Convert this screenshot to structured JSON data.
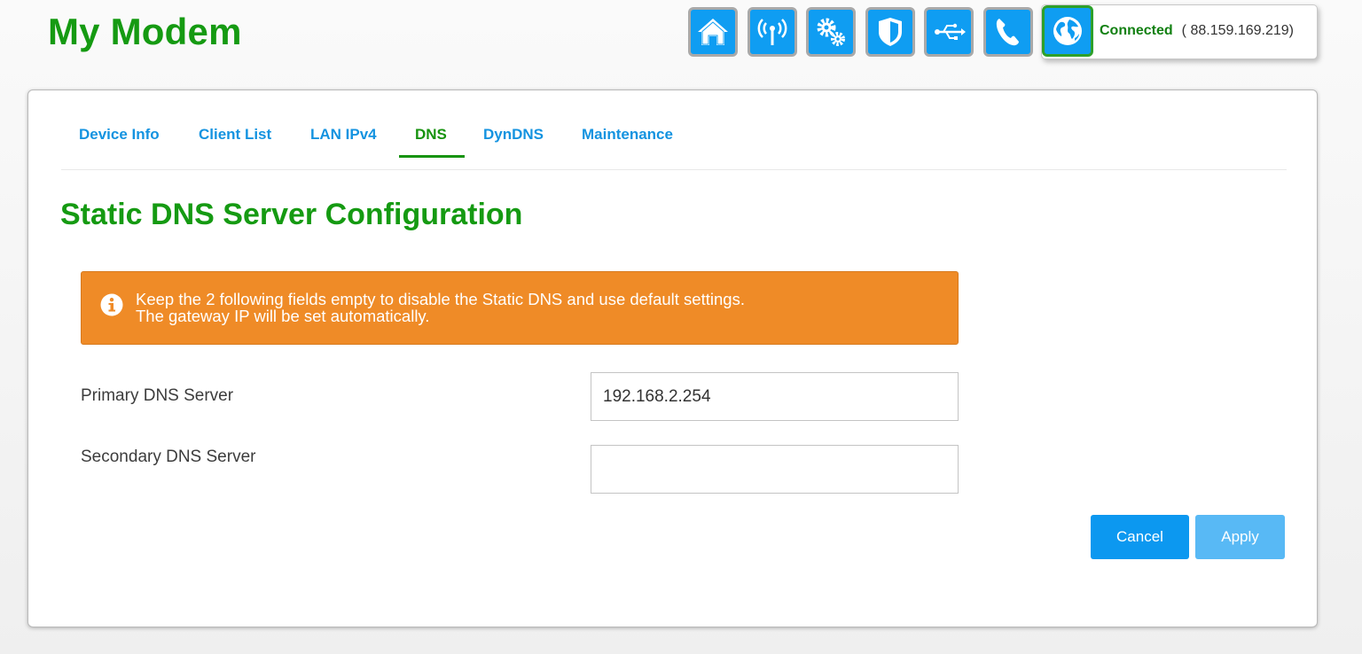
{
  "header": {
    "title": "My Modem"
  },
  "topnav": {
    "icons": [
      "home-icon",
      "wireless-icon",
      "settings-icon",
      "security-shield-icon",
      "usb-icon",
      "phone-icon"
    ]
  },
  "connection": {
    "icon": "globe-icon",
    "status": "Connected",
    "ip": "( 88.159.169.219)"
  },
  "tabs": [
    {
      "label": "Device Info",
      "active": false
    },
    {
      "label": "Client List",
      "active": false
    },
    {
      "label": "LAN IPv4",
      "active": false
    },
    {
      "label": "DNS",
      "active": true
    },
    {
      "label": "DynDNS",
      "active": false
    },
    {
      "label": "Maintenance",
      "active": false
    }
  ],
  "page": {
    "title": "Static DNS Server Configuration"
  },
  "alert": {
    "icon": "info-icon",
    "line1": "Keep the 2 following fields empty to disable the Static DNS and use default settings.",
    "line2": "The gateway IP will be set automatically."
  },
  "form": {
    "primary": {
      "label": "Primary DNS Server",
      "value": "192.168.2.254"
    },
    "secondary": {
      "label": "Secondary DNS Server",
      "value": ""
    }
  },
  "buttons": {
    "cancel": "Cancel",
    "apply": "Apply"
  },
  "colors": {
    "brand_green": "#159a12",
    "nav_blue": "#0f9df2",
    "link_blue": "#1493e0",
    "alert_orange": "#ef8b27",
    "apply_disabled": "#58b9f5"
  }
}
